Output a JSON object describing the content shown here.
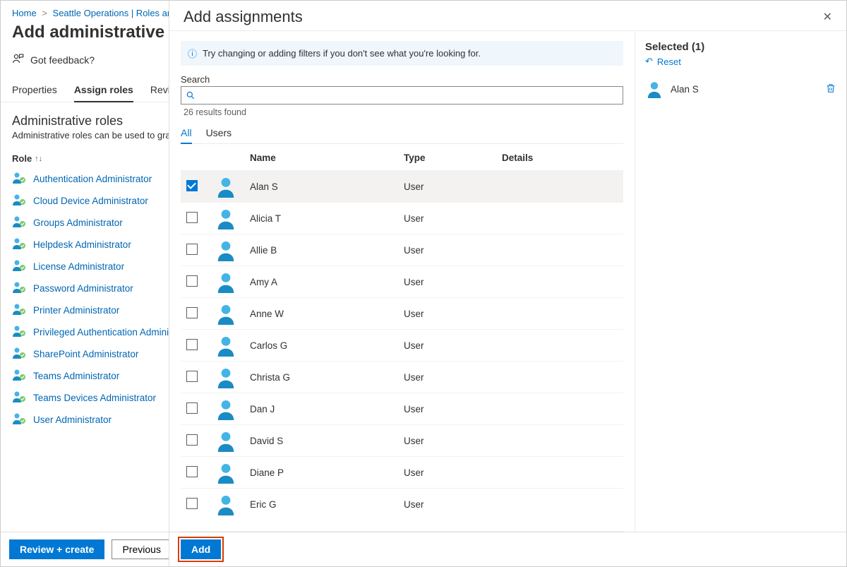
{
  "breadcrumb": {
    "home": "Home",
    "item1": "Seattle Operations | Roles and",
    "sep": ">"
  },
  "page_title": "Add administrative uni",
  "feedback_text": "Got feedback?",
  "tabs": {
    "properties": "Properties",
    "assign": "Assign roles",
    "review": "Review"
  },
  "roles_section": {
    "title": "Administrative roles",
    "subtitle": "Administrative roles can be used to grant",
    "col_role": "Role",
    "items": [
      "Authentication Administrator",
      "Cloud Device Administrator",
      "Groups Administrator",
      "Helpdesk Administrator",
      "License Administrator",
      "Password Administrator",
      "Printer Administrator",
      "Privileged Authentication Administ",
      "SharePoint Administrator",
      "Teams Administrator",
      "Teams Devices Administrator",
      "User Administrator"
    ]
  },
  "footer": {
    "review_create": "Review + create",
    "previous": "Previous",
    "add": "Add"
  },
  "flyout": {
    "title": "Add assignments",
    "info": "Try changing or adding filters if you don't see what you're looking for.",
    "search_label": "Search",
    "results": "26 results found",
    "tabs": {
      "all": "All",
      "users": "Users"
    },
    "columns": {
      "name": "Name",
      "type": "Type",
      "details": "Details"
    },
    "rows": [
      {
        "name": "Alan S",
        "type": "User",
        "selected": true
      },
      {
        "name": "Alicia T",
        "type": "User",
        "selected": false
      },
      {
        "name": "Allie B",
        "type": "User",
        "selected": false
      },
      {
        "name": "Amy A",
        "type": "User",
        "selected": false
      },
      {
        "name": "Anne W",
        "type": "User",
        "selected": false
      },
      {
        "name": "Carlos G",
        "type": "User",
        "selected": false
      },
      {
        "name": "Christa G",
        "type": "User",
        "selected": false
      },
      {
        "name": "Dan J",
        "type": "User",
        "selected": false
      },
      {
        "name": "David S",
        "type": "User",
        "selected": false
      },
      {
        "name": "Diane P",
        "type": "User",
        "selected": false
      },
      {
        "name": "Eric G",
        "type": "User",
        "selected": false
      }
    ],
    "selected_header": "Selected (1)",
    "reset": "Reset",
    "selected_item": "Alan S"
  }
}
